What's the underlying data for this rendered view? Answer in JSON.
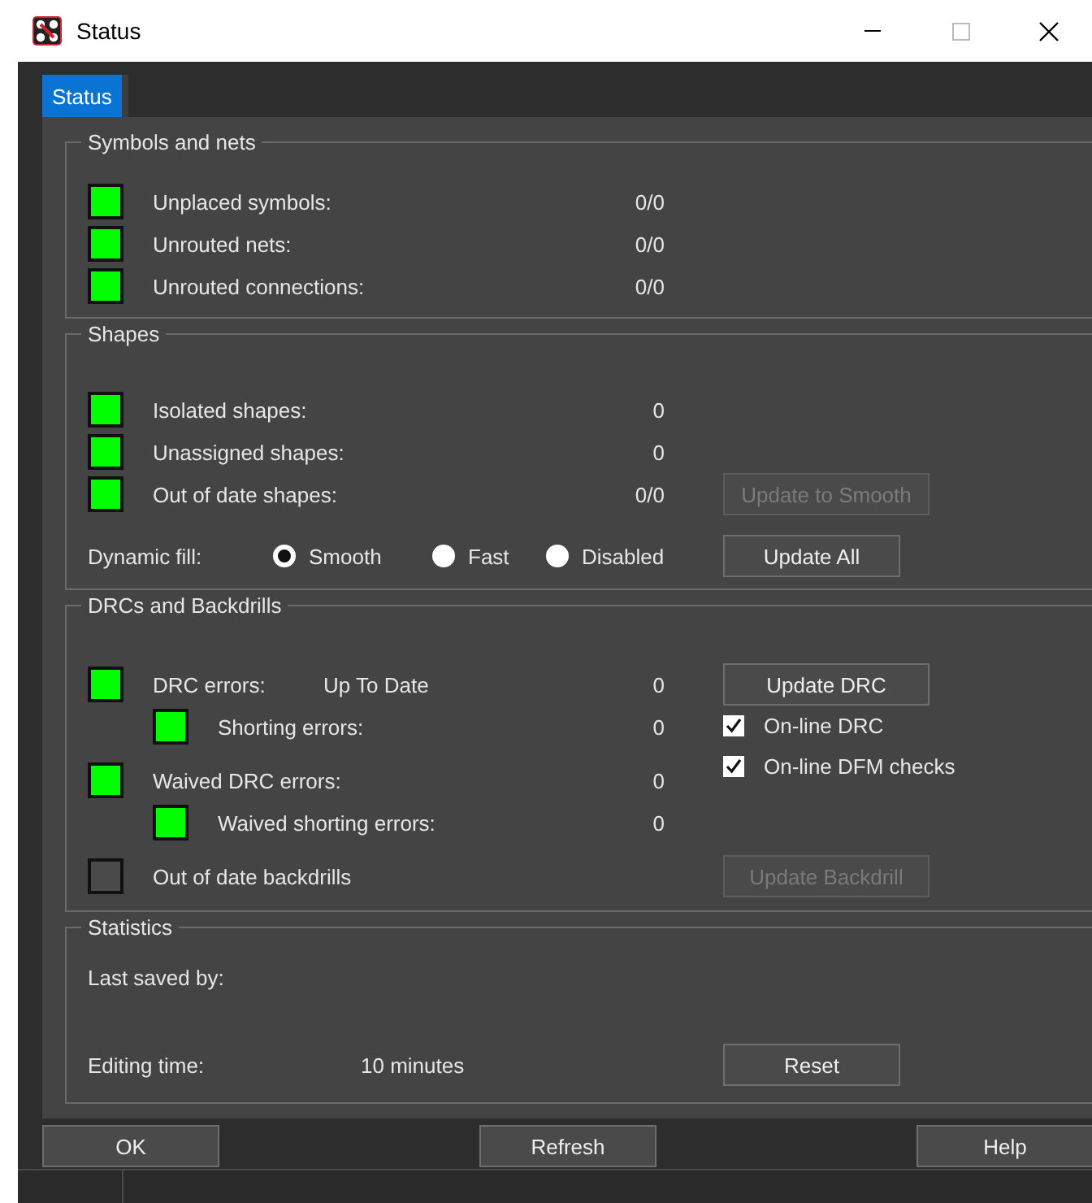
{
  "window": {
    "title": "Status"
  },
  "tabs": [
    {
      "label": "Status",
      "selected": true
    }
  ],
  "sections": [
    {
      "title": "Symbols and nets",
      "rows": [
        {
          "label": "Unplaced symbols:",
          "value": "0/0",
          "color": "#00ff00"
        },
        {
          "label": "Unrouted nets:",
          "value": "0/0",
          "color": "#00ff00"
        },
        {
          "label": "Unrouted connections:",
          "value": "0/0",
          "color": "#00ff00"
        }
      ]
    },
    {
      "title": "Shapes",
      "rows": [
        {
          "label": "Isolated shapes:",
          "value": "0",
          "color": "#00ff00"
        },
        {
          "label": "Unassigned shapes:",
          "value": "0",
          "color": "#00ff00"
        },
        {
          "label": "Out of date shapes:",
          "value": "0/0",
          "color": "#00ff00",
          "button": {
            "label": "Update to Smooth",
            "disabled": true
          }
        }
      ],
      "dynamic_fill": {
        "label": "Dynamic fill:",
        "options": [
          {
            "label": "Smooth",
            "selected": true
          },
          {
            "label": "Fast",
            "selected": false
          },
          {
            "label": "Disabled",
            "selected": false
          }
        ],
        "button": {
          "label": "Update All",
          "disabled": false
        }
      }
    },
    {
      "title": "DRCs and Backdrills",
      "rows": [
        {
          "label": "DRC errors:",
          "status": "Up To Date",
          "value": "0",
          "color": "#00ff00",
          "button": {
            "label": "Update DRC",
            "disabled": false
          },
          "children": [
            {
              "label": "Shorting errors:",
              "value": "0",
              "color": "#00ff00"
            }
          ]
        },
        {
          "label": "Waived DRC errors:",
          "value": "0",
          "color": "#00ff00",
          "children": [
            {
              "label": "Waived shorting errors:",
              "value": "0",
              "color": "#00ff00"
            }
          ]
        },
        {
          "label": "Out of date backdrills",
          "color": "#4a4a4a",
          "button": {
            "label": "Update Backdrill",
            "disabled": true
          }
        }
      ],
      "checkboxes": [
        {
          "label": "On-line DRC",
          "checked": true
        },
        {
          "label": "On-line DFM checks",
          "checked": true
        }
      ]
    },
    {
      "title": "Statistics",
      "fields": [
        {
          "label": "Last saved by:"
        },
        {
          "label": "Editing time:",
          "value": "10 minutes",
          "button": {
            "label": "Reset",
            "disabled": false
          }
        }
      ]
    }
  ],
  "footer_buttons": [
    "OK",
    "Refresh",
    "Help"
  ]
}
